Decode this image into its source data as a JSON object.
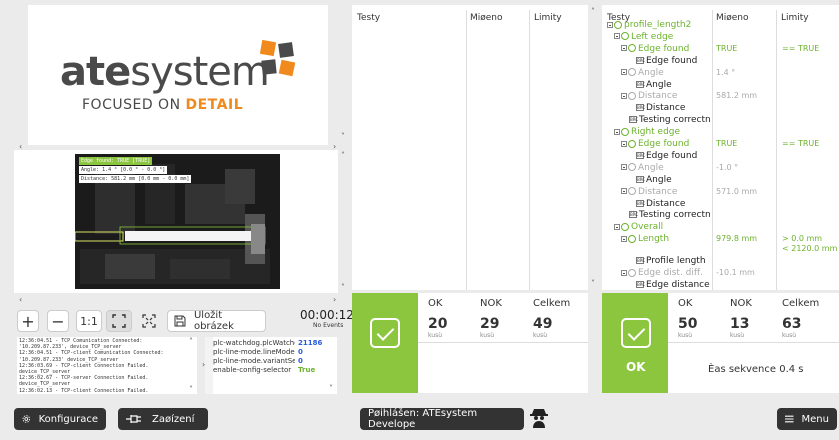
{
  "logo": {
    "brand_bold": "ate",
    "brand_light": "system",
    "tagline_a": "FOCUSED ON ",
    "tagline_b": "DETAIL"
  },
  "camera": {
    "edge_found_label": "Edge found: TRUE [TRUE]",
    "angle_label": "Angle: 1.4 ° [0.0 ° - 0.0 °]",
    "distance_label": "Distance: 581.2 mm [0.0 mm - 0.0 mm]"
  },
  "toolbar": {
    "zoom_in": "+",
    "zoom_out": "−",
    "one_to_one": "1:1",
    "save_image": "Uložit obrázek",
    "timer": "00:00:12",
    "events": "No Events"
  },
  "log": {
    "lines": [
      "12:36:04.51 - TCP Comunication Connected:",
      "'10.209.87.233', device_TCP_server",
      "12:36:04.51 - TCP-client Comunication Connected:",
      "'10.209.87.233' device_TCP_server",
      "12:36:03.69 - TCP-client Connection Failed.",
      "device_TCP_server",
      "12:36:02.67 - TCP-server Connection Failed.",
      "device_TCP_server",
      "12:36:02.13 - TCP-client Connection Failed."
    ]
  },
  "vars": [
    {
      "name": "plc-watchdog.plcWatchdog",
      "value": "21186",
      "color": "#2a5bd7"
    },
    {
      "name": "plc-line-mode.lineMode",
      "value": "0",
      "color": "#2a5bd7"
    },
    {
      "name": "plc-line-mode.variantSelect",
      "value": "0",
      "color": "#2a5bd7"
    },
    {
      "name": "enable-config-selector",
      "value": "True",
      "color": "#6cb32d"
    }
  ],
  "left_table": {
    "col1": "Testy",
    "col2": "Miøeno",
    "col3": "Limity"
  },
  "right_table": {
    "col1": "Testy",
    "col2": "Miøeno",
    "col3": "Limity"
  },
  "tree": [
    {
      "label": "profile_length2",
      "style": "green",
      "indent": 0,
      "icon": "circle",
      "value": "",
      "limit": ""
    },
    {
      "label": "Left edge",
      "style": "green",
      "indent": 1,
      "icon": "circle",
      "value": "",
      "limit": ""
    },
    {
      "label": "Edge found",
      "style": "green",
      "indent": 2,
      "icon": "circle",
      "value": "TRUE",
      "limit": "== TRUE",
      "vcolor": "#6cb32d"
    },
    {
      "label": "Edge found",
      "style": "dark",
      "indent": 3,
      "icon": "box",
      "value": "",
      "limit": ""
    },
    {
      "label": "Angle",
      "style": "dim",
      "indent": 2,
      "icon": "circle",
      "value": "1.4 °",
      "limit": "",
      "vcolor": "#aaa"
    },
    {
      "label": "Angle",
      "style": "dark",
      "indent": 3,
      "icon": "box",
      "value": "",
      "limit": ""
    },
    {
      "label": "Distance",
      "style": "dim",
      "indent": 2,
      "icon": "circle",
      "value": "581.2 mm",
      "limit": "",
      "vcolor": "#aaa"
    },
    {
      "label": "Distance",
      "style": "dark",
      "indent": 3,
      "icon": "box",
      "value": "",
      "limit": ""
    },
    {
      "label": "Testing correctn",
      "style": "dark",
      "indent": 2,
      "icon": "box",
      "value": "",
      "limit": ""
    },
    {
      "label": "Right edge",
      "style": "green",
      "indent": 1,
      "icon": "circle",
      "value": "",
      "limit": ""
    },
    {
      "label": "Edge found",
      "style": "green",
      "indent": 2,
      "icon": "circle",
      "value": "TRUE",
      "limit": "== TRUE",
      "vcolor": "#6cb32d"
    },
    {
      "label": "Edge found",
      "style": "dark",
      "indent": 3,
      "icon": "box",
      "value": "",
      "limit": ""
    },
    {
      "label": "Angle",
      "style": "dim",
      "indent": 2,
      "icon": "circle",
      "value": "-1.0 °",
      "limit": "",
      "vcolor": "#aaa"
    },
    {
      "label": "Angle",
      "style": "dark",
      "indent": 3,
      "icon": "box",
      "value": "",
      "limit": ""
    },
    {
      "label": "Distance",
      "style": "dim",
      "indent": 2,
      "icon": "circle",
      "value": "571.0 mm",
      "limit": "",
      "vcolor": "#aaa"
    },
    {
      "label": "Distance",
      "style": "dark",
      "indent": 3,
      "icon": "box",
      "value": "",
      "limit": ""
    },
    {
      "label": "Testing correctn",
      "style": "dark",
      "indent": 2,
      "icon": "box",
      "value": "",
      "limit": ""
    },
    {
      "label": "Overall",
      "style": "green",
      "indent": 1,
      "icon": "circle",
      "value": "",
      "limit": ""
    },
    {
      "label": "Length",
      "style": "green",
      "indent": 2,
      "icon": "circle",
      "value": "979.8 mm",
      "limit": "> 0.0 mm",
      "limit2": "< 2120.0 mm",
      "vcolor": "#6cb32d"
    },
    {
      "label": "Profile length",
      "style": "dark",
      "indent": 3,
      "icon": "box",
      "value": "",
      "limit": "",
      "gap": true
    },
    {
      "label": "Edge dist. diff.",
      "style": "dim",
      "indent": 2,
      "icon": "circle",
      "value": "-10.1 mm",
      "limit": "",
      "vcolor": "#aaa"
    },
    {
      "label": "Edge distance",
      "style": "dark",
      "indent": 3,
      "icon": "box",
      "value": "",
      "limit": ""
    }
  ],
  "left_results": {
    "ok_label": "OK",
    "nok_label": "NOK",
    "total_label": "Celkem",
    "ok": "20",
    "nok": "29",
    "total": "49",
    "unit": "kusù"
  },
  "right_results": {
    "ok_label": "OK",
    "nok_label": "NOK",
    "total_label": "Celkem",
    "ok": "50",
    "nok": "13",
    "total": "63",
    "unit": "kusù",
    "status": "OK",
    "sequence_time": "Èas sekvence 0.4 s"
  },
  "bottom": {
    "config": "Konfigurace",
    "devices": "Zaøízení",
    "logged_in": "Pøihlášen: ATEsystem Develope",
    "menu": "Menu"
  },
  "colors": {
    "accent_green": "#8cc63f",
    "brand_orange": "#f08a1c",
    "dark_button": "#333333"
  }
}
